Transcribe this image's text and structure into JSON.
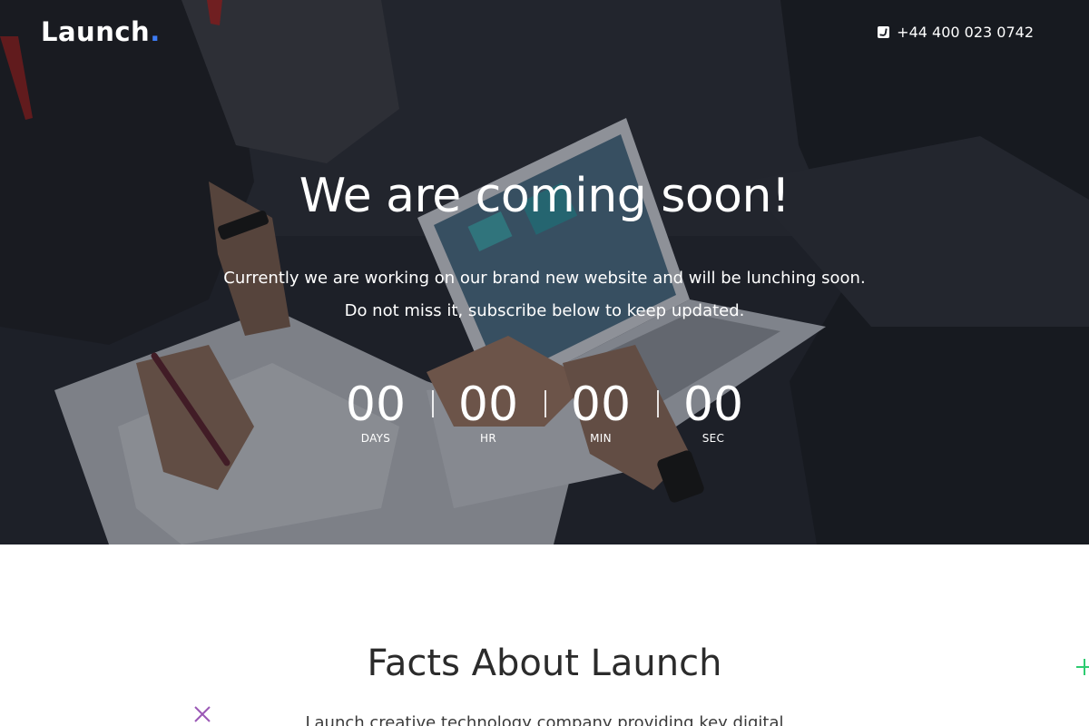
{
  "header": {
    "logo_text": "Launch",
    "logo_dot": ".",
    "phone": "+44 400 023 0742",
    "phone_icon": "phone-icon"
  },
  "hero": {
    "headline": "We are coming soon!",
    "intro_line1": "Currently we are working on our brand new website and will be lunching soon.",
    "intro_line2": "Do not miss it, subscribe below to keep updated."
  },
  "countdown": [
    {
      "value": "00",
      "label": "DAYS"
    },
    {
      "value": "00",
      "label": "HR"
    },
    {
      "value": "00",
      "label": "MIN"
    },
    {
      "value": "00",
      "label": "SEC"
    }
  ],
  "facts": {
    "title": "Facts About Launch",
    "description": "Launch creative technology company providing key digital"
  },
  "colors": {
    "brand_accent": "#3d7cf5",
    "hero_overlay": "#1b1e27",
    "deco_purple": "#9b59b6",
    "deco_green": "#2ecc71"
  }
}
